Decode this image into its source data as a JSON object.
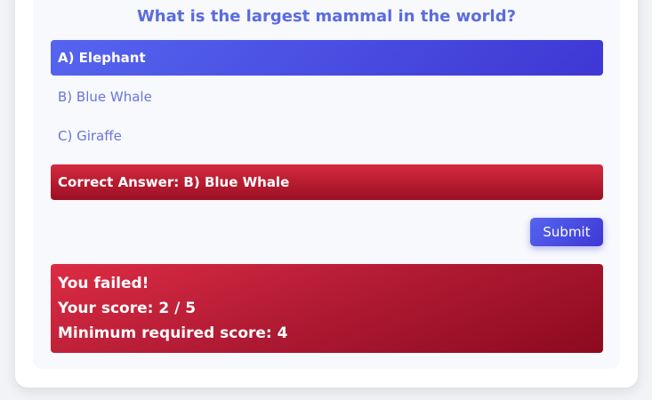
{
  "quiz": {
    "question": "What is the largest mammal in the world?",
    "options": [
      {
        "label": "A) Elephant",
        "state": "selected"
      },
      {
        "label": "B) Blue Whale",
        "state": "unselected"
      },
      {
        "label": "C) Giraffe",
        "state": "unselected"
      }
    ],
    "correct_answer": "Correct Answer: B) Blue Whale",
    "submit_label": "Submit"
  },
  "result": {
    "status": "You failed!",
    "score": "Your score: 2 / 5",
    "minimum": "Minimum required score: 4"
  },
  "colors": {
    "accent": "#4a4fe0",
    "question_text": "#5b6be0",
    "option_text": "#6b74d9",
    "failure": "#c21a34",
    "panel_background": "#f7f9fc"
  }
}
